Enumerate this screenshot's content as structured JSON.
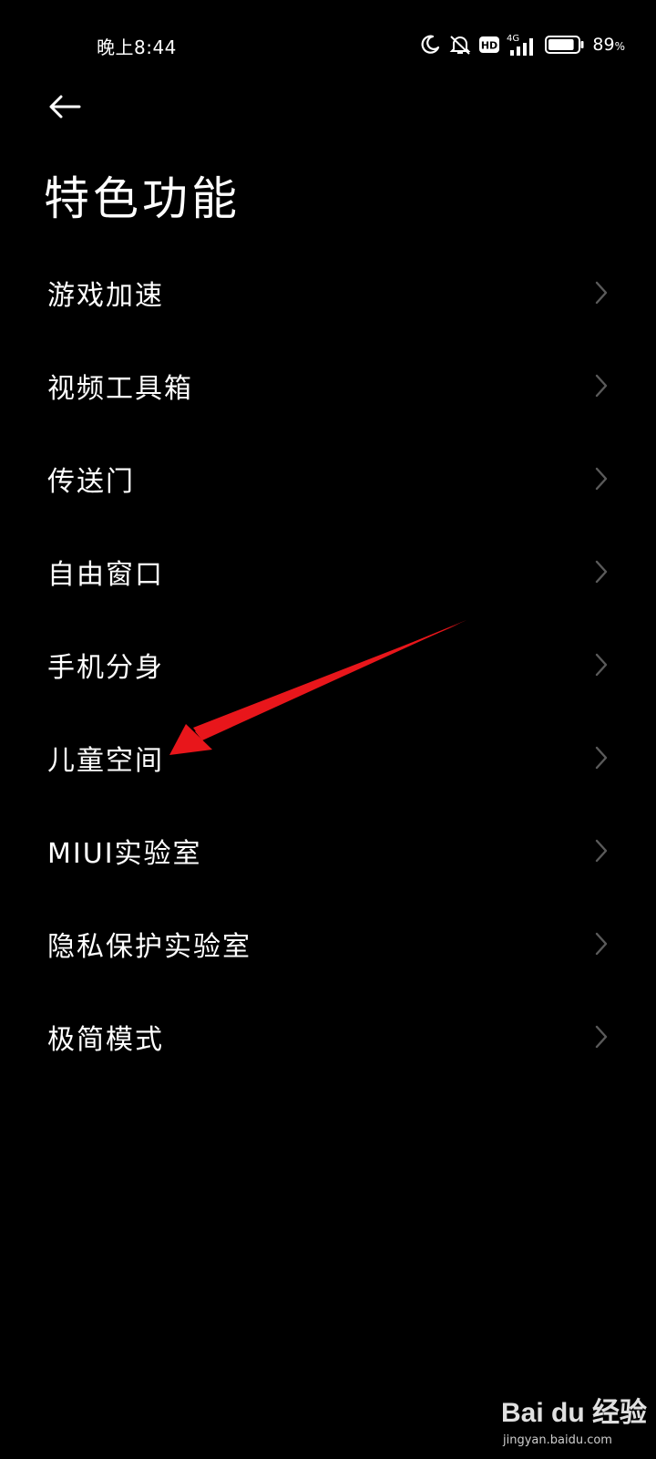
{
  "status_bar": {
    "time": "晚上8:44",
    "network": "4G",
    "hd_badge": "HD",
    "battery_percent": "89",
    "battery_unit": "%",
    "battery_level": 0.89,
    "icons": [
      "moon-icon",
      "mute-icon",
      "hd-icon",
      "signal-icon",
      "battery-icon"
    ]
  },
  "header": {
    "back_icon": "back-arrow-icon",
    "title": "特色功能"
  },
  "menu": {
    "items": [
      {
        "label": "游戏加速"
      },
      {
        "label": "视频工具箱"
      },
      {
        "label": "传送门"
      },
      {
        "label": "自由窗口"
      },
      {
        "label": "手机分身"
      },
      {
        "label": "儿童空间"
      },
      {
        "label": "MIUI实验室"
      },
      {
        "label": "隐私保护实验室"
      },
      {
        "label": "极简模式"
      }
    ],
    "chevron_icon": "chevron-right-icon"
  },
  "annotation": {
    "color": "#e8161b",
    "points_to": "儿童空间"
  },
  "watermark": {
    "logo_text": "Bai du 经验",
    "url": "jingyan.baidu.com"
  }
}
